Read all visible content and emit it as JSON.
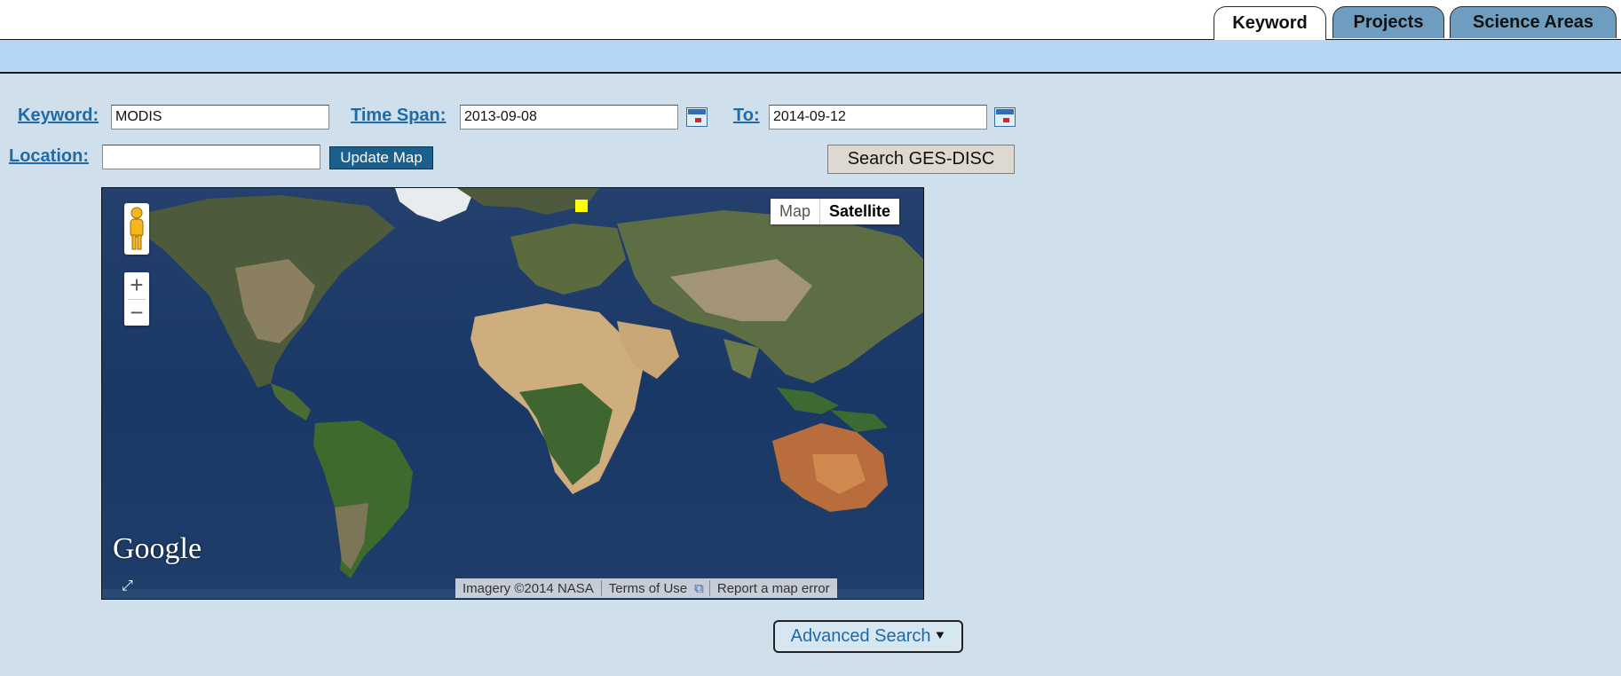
{
  "tabs": [
    {
      "label": "Keyword",
      "active": true
    },
    {
      "label": "Projects",
      "active": false
    },
    {
      "label": "Science Areas",
      "active": false
    }
  ],
  "form": {
    "keyword_label": "Keyword:",
    "keyword_value": "MODIS",
    "timespan_label": "Time Span:",
    "start_date": "2013-09-08",
    "to_label": "To:",
    "end_date": "2014-09-12",
    "location_label": "Location:",
    "location_value": "",
    "update_map_label": "Update Map",
    "search_label": "Search GES-DISC"
  },
  "map": {
    "type_map_label": "Map",
    "type_satellite_label": "Satellite",
    "selected_type": "Satellite",
    "zoom_in": "+",
    "zoom_out": "−",
    "logo": "Google",
    "imagery_credit": "Imagery ©2014 NASA",
    "terms_label": "Terms of Use",
    "report_label": "Report a map error"
  },
  "advanced_search_label": "Advanced Search",
  "icons": {
    "calendar": "calendar-icon",
    "pegman": "street-view-pegman-icon",
    "expand": "expand-icon",
    "external_link": "external-link-icon",
    "chevron": "double-chevron-down-icon"
  },
  "colors": {
    "page_bg": "#cfe0ec",
    "band": "#b4d6f4",
    "link": "#1f6aa8",
    "tab_inactive": "#6f9dc0",
    "update_btn": "#1b5f8c",
    "marker": "#ffff00"
  }
}
